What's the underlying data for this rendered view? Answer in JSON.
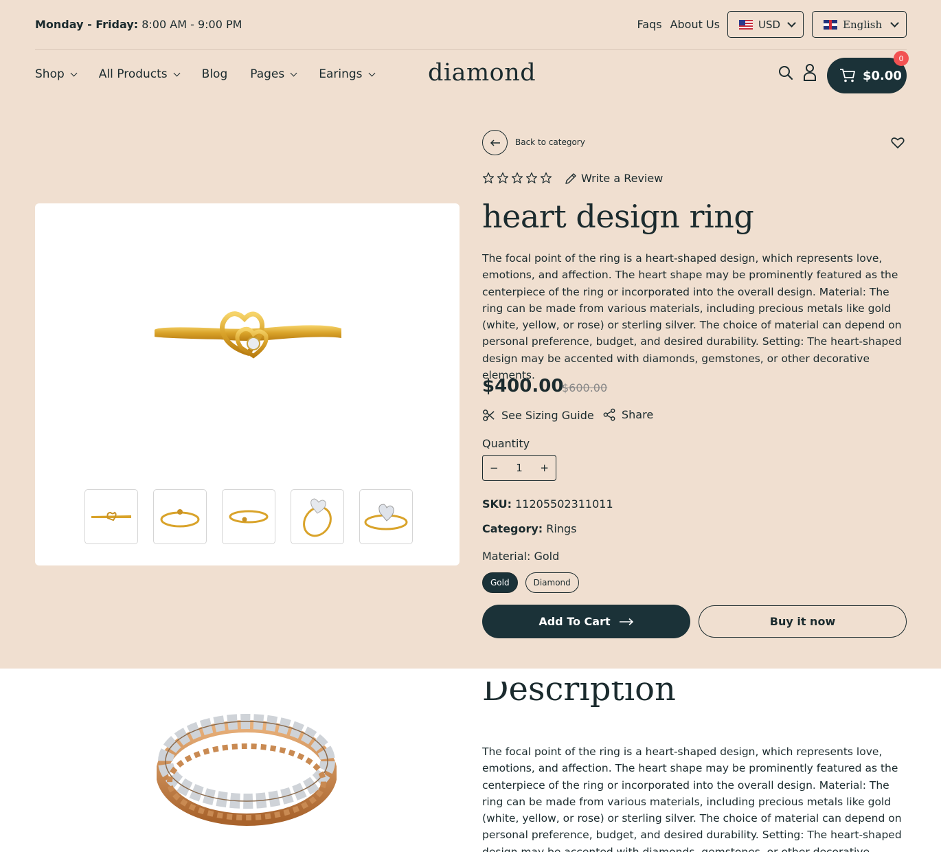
{
  "topbar": {
    "hours_label": "Monday - Friday:",
    "hours_value": "8:00 AM - 9:00 PM",
    "links": [
      "Faqs",
      "About Us"
    ],
    "currency": "USD",
    "language": "English"
  },
  "nav": {
    "items": [
      {
        "label": "Shop",
        "dropdown": true
      },
      {
        "label": "All Products",
        "dropdown": true
      },
      {
        "label": "Blog",
        "dropdown": false
      },
      {
        "label": "Pages",
        "dropdown": true
      },
      {
        "label": "Earings",
        "dropdown": true
      }
    ],
    "logo": "diamond",
    "cart_total": "$0.00",
    "cart_count": "0"
  },
  "product": {
    "back_label": "Back to category",
    "review_label": "Write a Review",
    "rating": 0,
    "title": "heart design ring",
    "description": "The focal point of the ring is a heart-shaped design, which represents love, emotions, and affection. The heart shape may be prominently featured as the centerpiece of the ring or incorporated into the overall design. Material: The ring can be made from various materials, including precious metals like gold (white, yellow, or rose) or sterling silver. The choice of material can depend on personal preference, budget, and desired durability. Setting: The heart-shaped design may be accented with diamonds, gemstones, or other decorative elements.",
    "price": "$400.00",
    "old_price": "$600.00",
    "sizing_label": "See Sizing Guide",
    "share_label": "Share",
    "quantity_label": "Quantity",
    "quantity": "1",
    "sku_label": "SKU:",
    "sku": "11205502311011",
    "category_label": "Category:",
    "category": "Rings",
    "material_label": "Material: Gold",
    "materials": [
      "Gold",
      "Diamond"
    ],
    "add_to_cart": "Add To Cart",
    "buy_now": "Buy it now"
  },
  "description_section": {
    "heading": "Description",
    "text": "The focal point of the ring is a heart-shaped design, which represents love, emotions, and affection. The heart shape may be prominently featured as the centerpiece of the ring or incorporated into the overall design. Material: The ring can be made from various materials, including precious metals like gold (white, yellow, or rose) or sterling silver. The choice of material can depend on personal preference, budget, and desired durability. Setting: The heart-shaped design may be accented with diamonds, gemstones, or other decorative elements."
  },
  "colors": {
    "background": "#f0dfd0",
    "dark": "#1b3238",
    "badge": "#f25252",
    "gold": "#d9a830"
  }
}
